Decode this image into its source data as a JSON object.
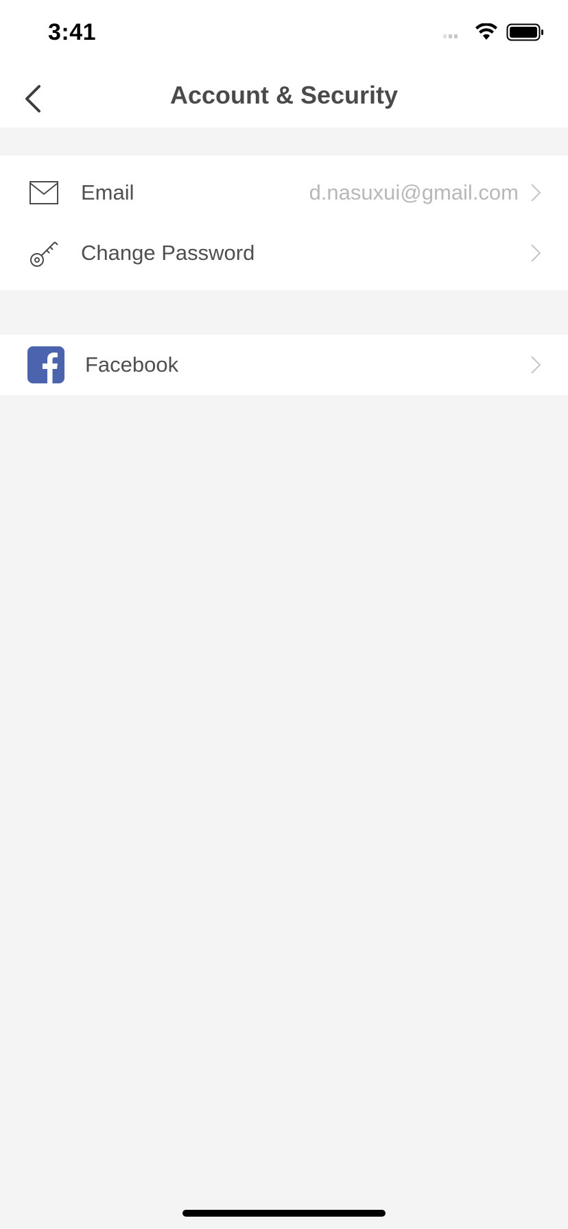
{
  "status_bar": {
    "time": "3:41"
  },
  "nav": {
    "title": "Account & Security",
    "back_icon": "chevron-left-icon"
  },
  "security_items": [
    {
      "icon": "envelope-icon",
      "label": "Email",
      "value": "d.nasuxui@gmail.com"
    },
    {
      "icon": "key-icon",
      "label": "Change Password",
      "value": ""
    }
  ],
  "linked_accounts": [
    {
      "icon": "facebook-icon",
      "label": "Facebook"
    }
  ],
  "colors": {
    "background": "#f4f4f4",
    "surface": "#ffffff",
    "title_text": "#4a4a4a",
    "label_text": "#4f4f4f",
    "secondary_text": "#b8b8b8",
    "facebook_blue": "#4b64ad"
  }
}
